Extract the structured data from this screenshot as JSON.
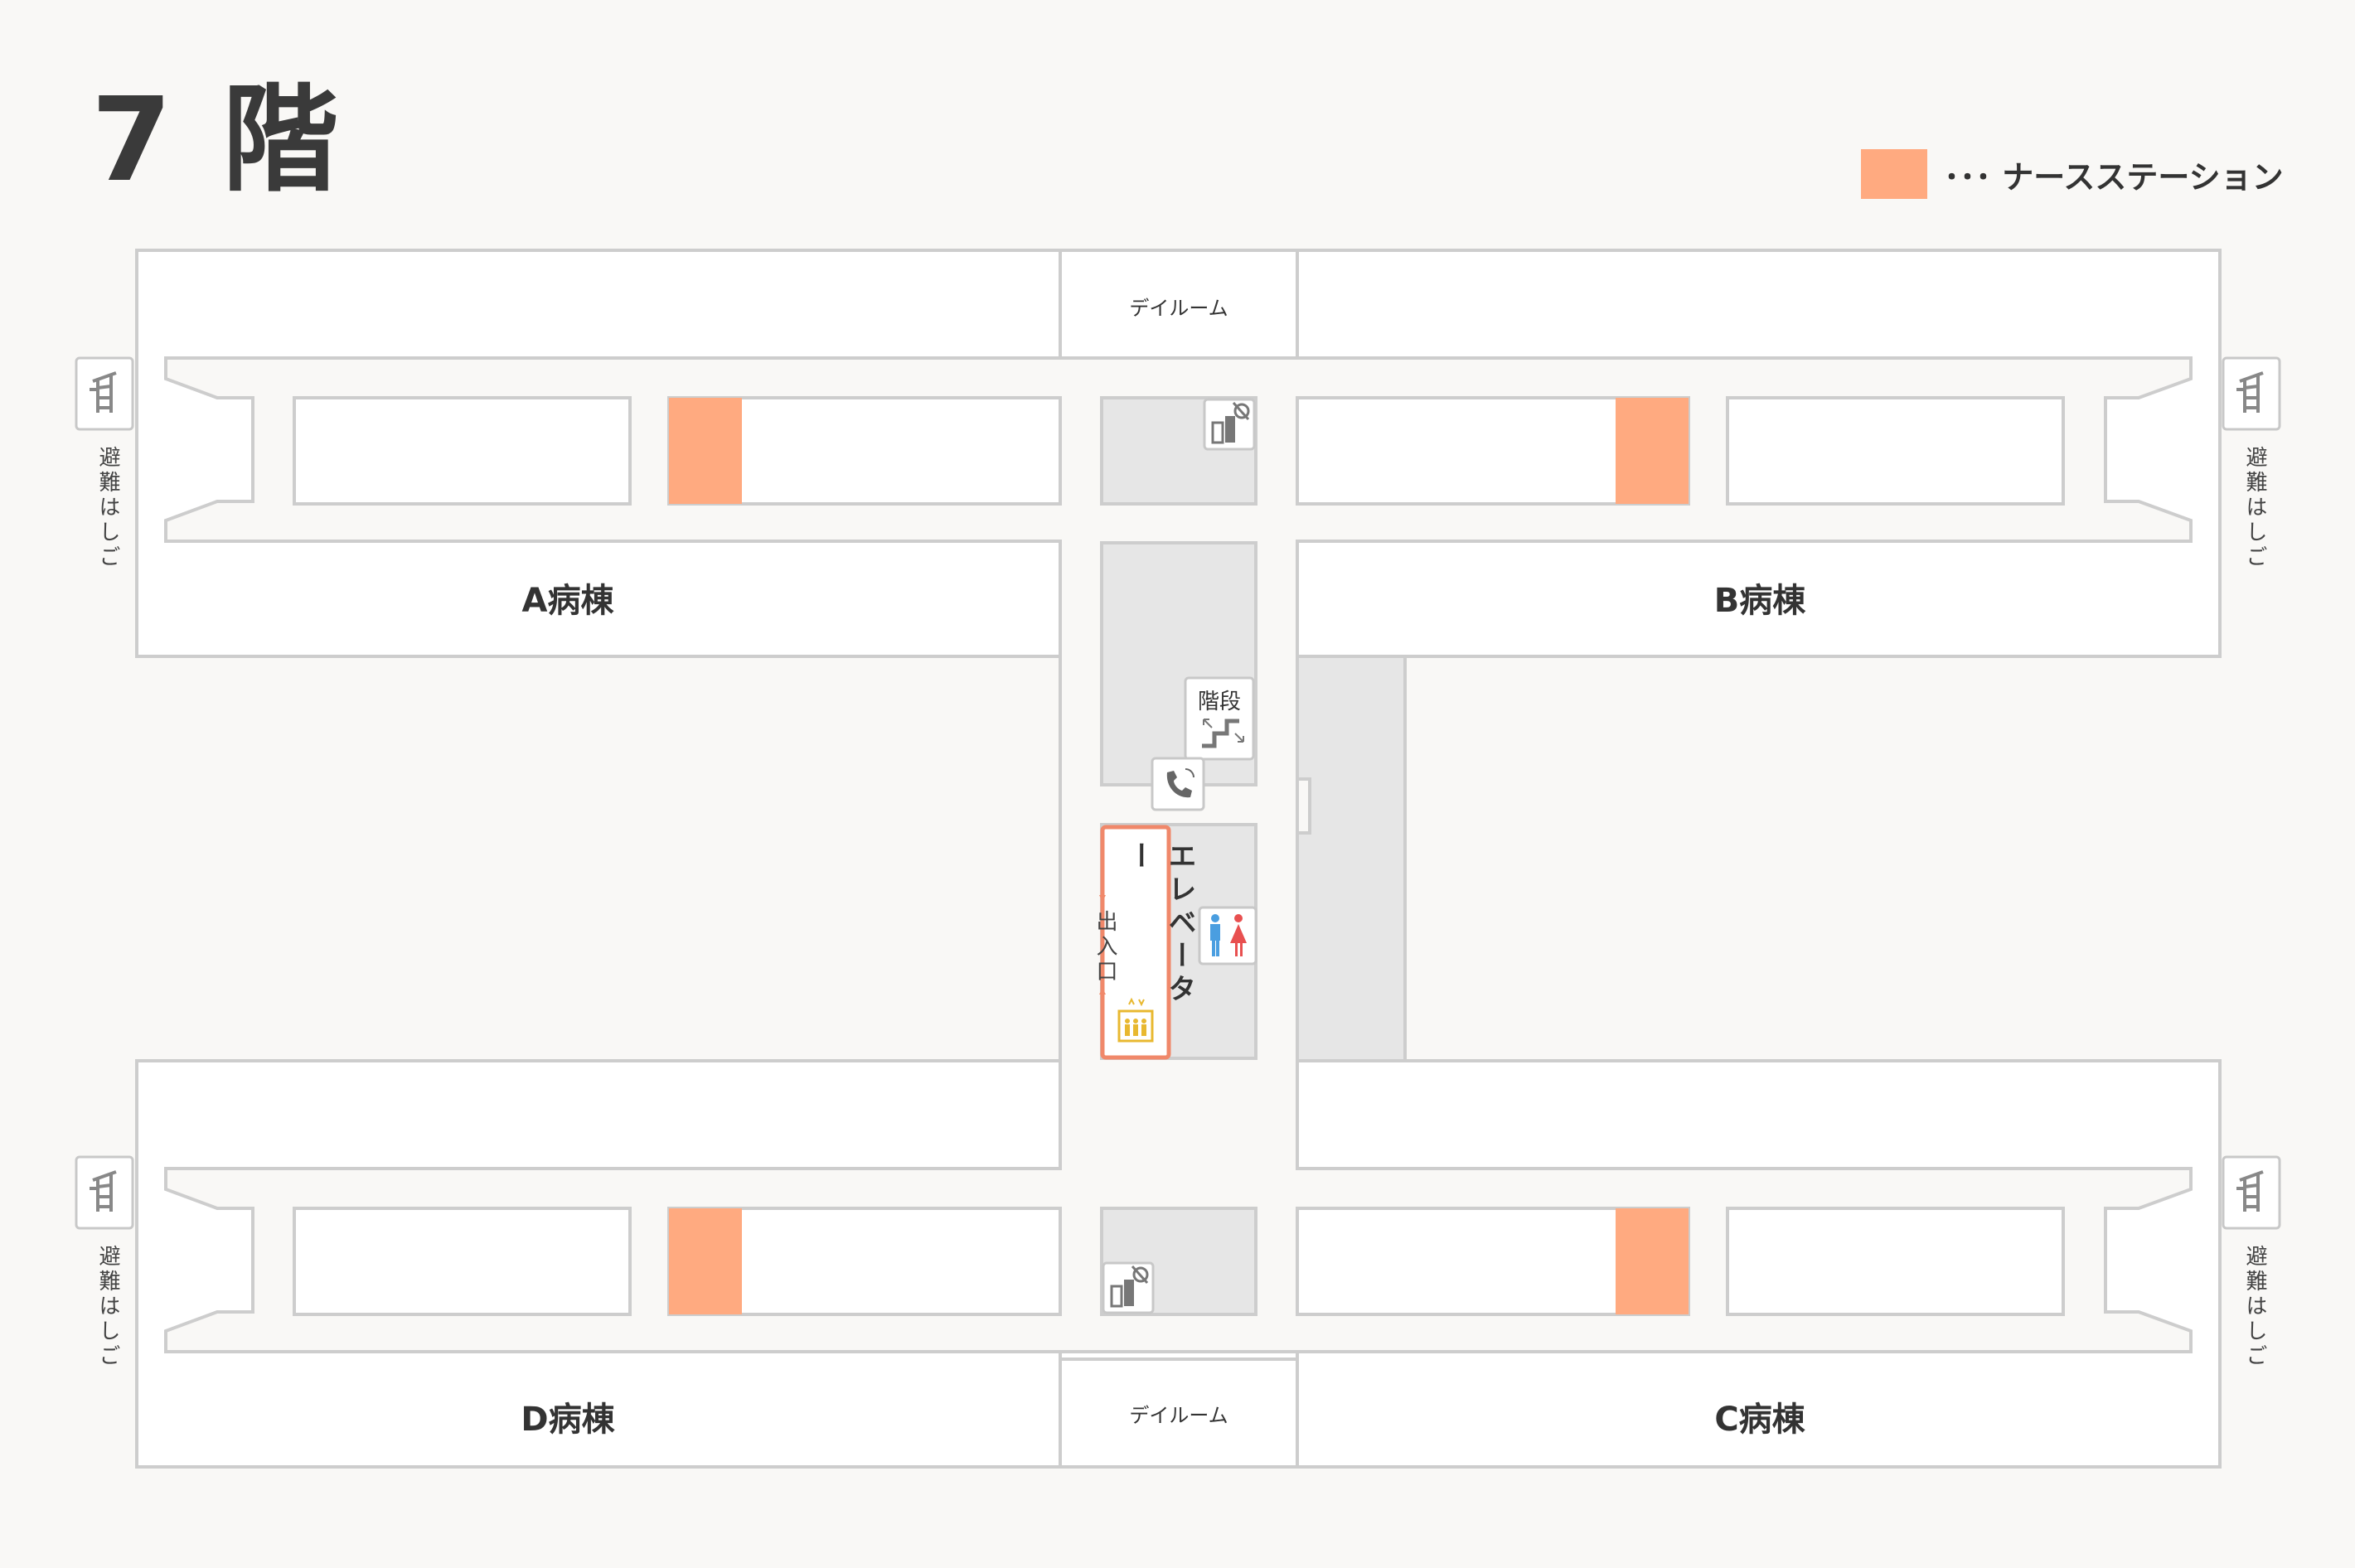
{
  "floor": {
    "title": "7 階"
  },
  "legend": {
    "text": "･･･ ナースステーション",
    "swatch_color": "#ffaa80",
    "swatch_meaning": "ナースステーション"
  },
  "wards": {
    "a": "A病棟",
    "b": "B病棟",
    "c": "C病棟",
    "d": "D病棟"
  },
  "rooms": {
    "dayroom_top": "デイルーム",
    "dayroom_bottom": "デイルーム",
    "stairs": "階段",
    "elevator": "エレベーター",
    "entrance": "出入口"
  },
  "escape_ladder": {
    "label": "避難はしご"
  },
  "icons": {
    "escape_ladder": "escape-ladder-icon",
    "fire_extinguisher": "fire-extinguisher-icon",
    "stairs": "stairs-icon",
    "phone": "phone-icon",
    "restroom": "restroom-icon",
    "elevator": "elevator-icon"
  },
  "colors": {
    "nurse_station": "#ffaa80",
    "elevator_border": "#f0886a",
    "elevator_icon": "#e8b830",
    "restroom_male": "#4a9ee0",
    "restroom_female": "#e85050"
  }
}
